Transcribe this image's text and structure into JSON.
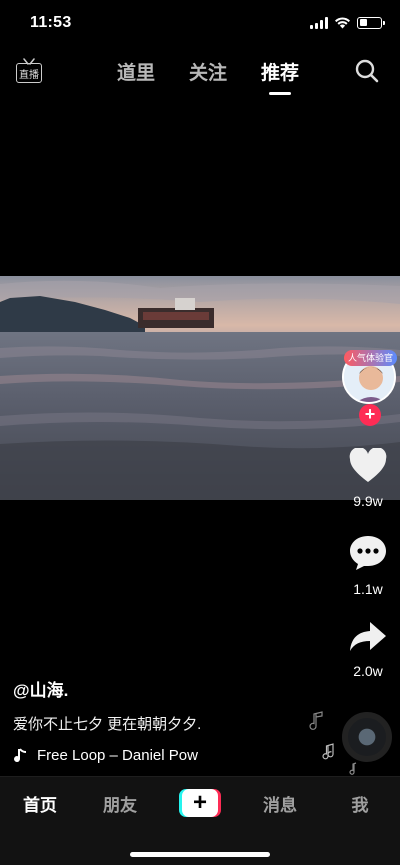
{
  "status_bar": {
    "time": "11:53"
  },
  "top_nav": {
    "live_label": "直播",
    "tabs": [
      {
        "label": "道里"
      },
      {
        "label": "关注"
      },
      {
        "label": "推荐"
      }
    ],
    "active_tab": "推荐"
  },
  "creator": {
    "badge": "人气体验官",
    "follow_symbol": "+"
  },
  "actions": {
    "likes": "9.9w",
    "comments": "1.1w",
    "shares": "2.0w"
  },
  "caption": {
    "author": "@山海.",
    "description": "爱你不止七夕 更在朝朝夕夕.",
    "music": "Free Loop – Daniel Pow"
  },
  "bottom_nav": {
    "items": [
      {
        "label": "首页"
      },
      {
        "label": "朋友"
      },
      {
        "label": "+"
      },
      {
        "label": "消息"
      },
      {
        "label": "我"
      }
    ],
    "active": "首页"
  },
  "colors": {
    "accent_red": "#fe2c55",
    "accent_cyan": "#25f4ee",
    "background": "#000000"
  }
}
